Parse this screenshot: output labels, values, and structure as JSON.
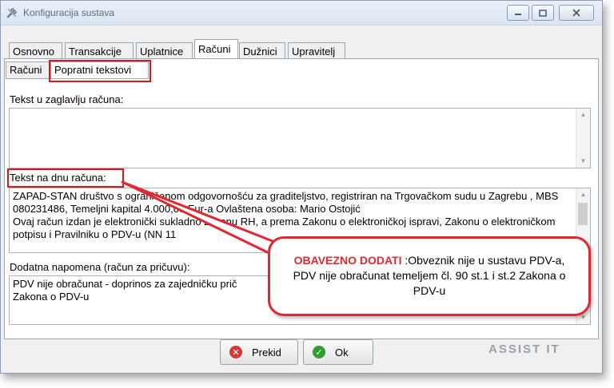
{
  "window": {
    "title": "Konfiguracija sustava",
    "app_icon": "tools-icon",
    "controls": [
      "minimize-icon",
      "maximize-icon",
      "close-icon"
    ]
  },
  "tabs": [
    "Osnovno",
    "Transakcije",
    "Uplatnice",
    "Računi",
    "Dužnici",
    "Upravitelj"
  ],
  "active_tab": "Računi",
  "subtabs": [
    "Računi",
    "Popratni tekstovi"
  ],
  "active_subtab": "Popratni tekstovi",
  "fields": {
    "header_label": "Tekst u zaglavlju računa:",
    "header_value": "",
    "footer_label": "Tekst na dnu računa:",
    "footer_value": "ZAPAD-STAN društvo s ograničenom odgovornošću za graditeljstvo, registriran na Trgovačkom sudu u Zagrebu , MBS 080231486, Temeljni kapital 4.000,00 Eur-a Ovlaštena osoba: Mario Ostojić\nOvaj račun izdan je elektronički sukladno zakonu RH, a prema Zakonu o elektroničkoj ispravi, Zakonu o elektroničkom potpisu i Pravilniku o PDV-u (NN 11",
    "note_label": "Dodatna napomena (račun za pričuvu):",
    "note_value": "PDV nije obračunat - doprinos za zajedničku prič\nZakona o PDV-u"
  },
  "callout": {
    "highlight": "OBAVEZNO DODATI",
    "text": " :Obveznik nije u sustavu PDV-a, PDV nije obračunat temeljem čl. 90 st.1 i st.2 Zakona o PDV-u"
  },
  "buttons": {
    "cancel_label": "Prekid",
    "cancel_icon": "cancel-icon",
    "ok_label": "Ok",
    "ok_icon": "check-icon"
  },
  "logo": "ASSIST IT",
  "colors": {
    "highlight": "#e2141b",
    "ok_green": "#2f9e2f",
    "cancel_red": "#d23a3a"
  }
}
